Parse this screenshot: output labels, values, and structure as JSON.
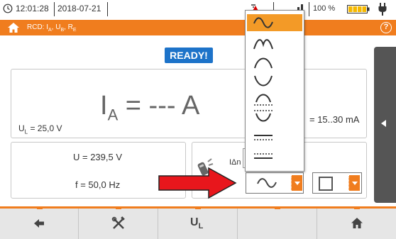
{
  "status_bar": {
    "time": "12:01:28",
    "date": "2018-07-21",
    "battery_percent": "100 %"
  },
  "header": {
    "title_parts": {
      "rcd": "RCD: I",
      "a_sub": "A",
      "sep1": ", U",
      "b_sub": "B",
      "sep2": ", R",
      "e_sub": "E"
    },
    "help_label": "?"
  },
  "ready_badge": "READY!",
  "result": {
    "main_i": "I",
    "main_sub": "A",
    "main_rest": " = --- A",
    "ul_u": "U",
    "ul_sub": "L",
    "ul_rest": " = 25,0 V",
    "idn_range": "= 15..30 mA"
  },
  "measurements": {
    "voltage": "U = 239,5 V",
    "frequency": "f = 50,0 Hz"
  },
  "settings": {
    "idn_label": "IΔn"
  },
  "waveform_options": [
    {
      "name": "sine",
      "selected": true
    },
    {
      "name": "positive-half-wave",
      "selected": false
    },
    {
      "name": "negative-half-wave",
      "selected": false
    },
    {
      "name": "positive-half-wave-dc",
      "selected": false
    },
    {
      "name": "negative-half-wave-dc",
      "selected": false
    },
    {
      "name": "dc-positive",
      "selected": false
    },
    {
      "name": "dc-negative",
      "selected": false
    }
  ],
  "selected_waveform_icon": "sine-wave-icon",
  "toolbar": {
    "ul_u": "U",
    "ul_sub": "L"
  },
  "colors": {
    "accent": "#f07d1e",
    "badge": "#1d73c9",
    "selection": "#f39a27",
    "arrow": "#e8161c"
  }
}
